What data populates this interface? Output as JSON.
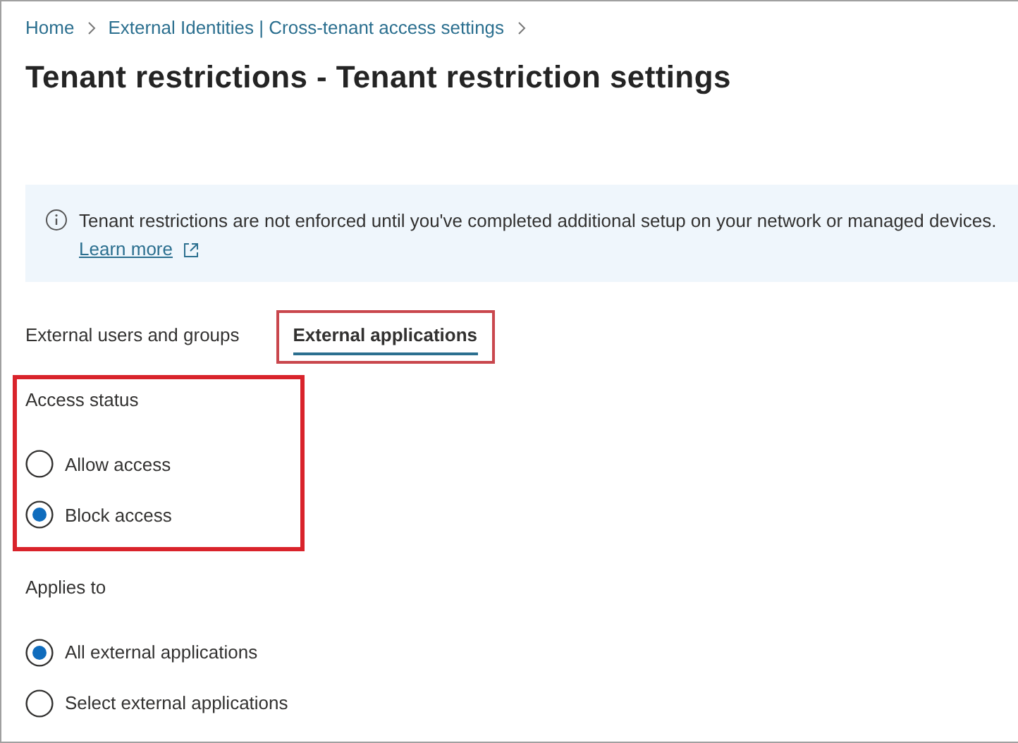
{
  "breadcrumb": [
    {
      "label": "Home"
    },
    {
      "label": "External Identities | Cross-tenant access settings"
    }
  ],
  "title": "Tenant restrictions - Tenant restriction settings",
  "info_banner": {
    "text": "Tenant restrictions are not enforced until you've completed additional setup on your network or managed devices.",
    "link": "Learn more"
  },
  "tabs": [
    {
      "label": "External users and groups",
      "selected": false,
      "highlighted": false
    },
    {
      "label": "External applications",
      "selected": true,
      "highlighted": true
    }
  ],
  "groups": [
    {
      "label": "Access status",
      "highlighted": true,
      "options": [
        {
          "label": "Allow access",
          "selected": false
        },
        {
          "label": "Block access",
          "selected": true
        }
      ]
    },
    {
      "label": "Applies to",
      "highlighted": false,
      "options": [
        {
          "label": "All external applications",
          "selected": true
        },
        {
          "label": "Select external applications",
          "selected": false
        }
      ]
    }
  ]
}
